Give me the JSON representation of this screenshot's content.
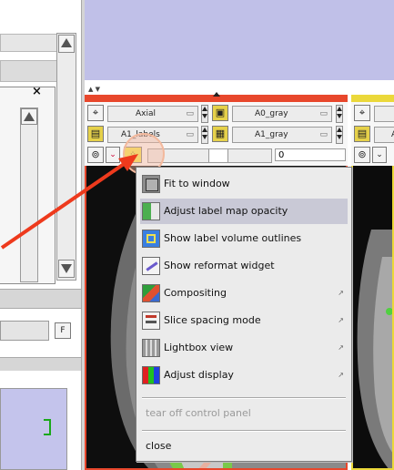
{
  "colors": {
    "view_bg": "#c0c0e8",
    "red_bar": "#e8472c",
    "yellow_bar": "#ebd83a",
    "arrow": "#ee3a1d",
    "highlight_circle": "#f6b8a0",
    "menu_bg": "#ebebeb",
    "menu_highlight": "#c9c9d6"
  },
  "slicer_left": {
    "orientation": "Axial",
    "background_volume": "A0_gray",
    "label_volume": "A1_labels",
    "foreground_volume": "A1_gray",
    "slice_value": "0"
  },
  "slicer_right": {
    "row1_partial": "",
    "row2_partial": "A"
  },
  "left_panel": {
    "close_symbol": "×",
    "small_button_icon": "file-icon"
  },
  "menu": {
    "items": [
      {
        "label": "Fit to window",
        "icon": "fit-to-window-icon",
        "submenu": false,
        "highlighted": false
      },
      {
        "label": "Adjust label map opacity",
        "icon": "label-opacity-icon",
        "submenu": false,
        "highlighted": true
      },
      {
        "label": "Show label volume outlines",
        "icon": "label-outline-icon",
        "submenu": false,
        "highlighted": false
      },
      {
        "label": "Show reformat widget",
        "icon": "reformat-widget-icon",
        "submenu": false,
        "highlighted": false
      },
      {
        "label": "Compositing",
        "icon": "compositing-icon",
        "submenu": true,
        "highlighted": false
      },
      {
        "label": "Slice spacing mode",
        "icon": "slice-spacing-icon",
        "submenu": true,
        "highlighted": false
      },
      {
        "label": "Lightbox view",
        "icon": "lightbox-icon",
        "submenu": true,
        "highlighted": false
      },
      {
        "label": "Adjust display",
        "icon": "adjust-display-icon",
        "submenu": true,
        "highlighted": false
      }
    ],
    "tear_off": "tear off control panel",
    "close": "close"
  }
}
